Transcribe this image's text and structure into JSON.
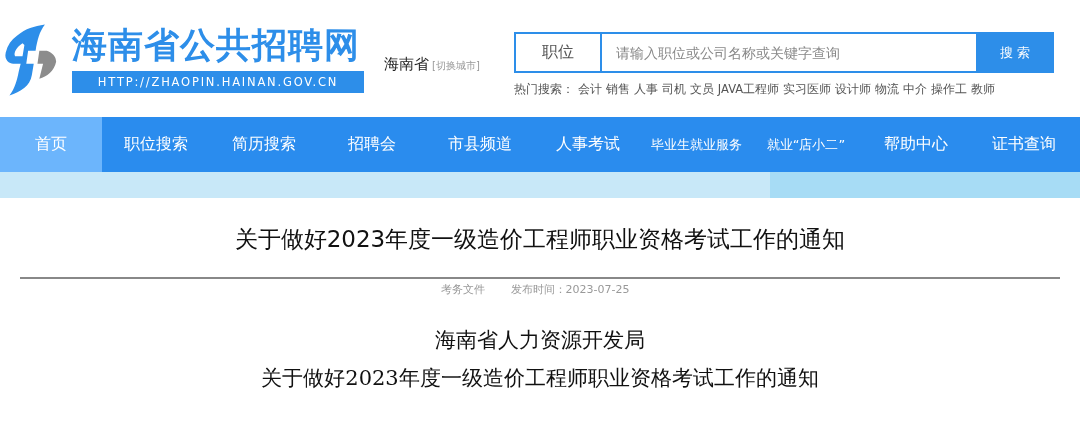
{
  "logo": {
    "name": "海南省公共招聘网",
    "url": "HTTP://ZHAOPIN.HAINAN.GOV.CN"
  },
  "city": {
    "name": "海南省",
    "switch": "[切换城市]"
  },
  "search": {
    "category": "职位",
    "placeholder": "请输入职位或公司名称或关键字查询",
    "button": "搜 索"
  },
  "hot_search": {
    "label": "热门搜索：",
    "terms": [
      "会计",
      "销售",
      "人事",
      "司机",
      "文员",
      "JAVA工程师",
      "实习医师",
      "设计师",
      "物流",
      "中介",
      "操作工",
      "教师"
    ]
  },
  "nav": [
    {
      "label": "首页",
      "selected": true
    },
    {
      "label": "职位搜索",
      "selected": false
    },
    {
      "label": "简历搜索",
      "selected": false
    },
    {
      "label": "招聘会",
      "selected": false
    },
    {
      "label": "市县频道",
      "selected": false
    },
    {
      "label": "人事考试",
      "selected": false
    },
    {
      "label": "毕业生就业服务",
      "selected": false
    },
    {
      "label": "就业“店小二”",
      "selected": false
    },
    {
      "label": "帮助中心",
      "selected": false
    },
    {
      "label": "证书查询",
      "selected": false
    }
  ],
  "article": {
    "title": "关于做好2023年度一级造价工程师职业资格考试工作的通知",
    "category": "考务文件",
    "published": "发布时间：2023-07-25",
    "body_lines": [
      "海南省人力资源开发局",
      "关于做好2023年度一级造价工程师职业资格考试工作的通知"
    ]
  }
}
